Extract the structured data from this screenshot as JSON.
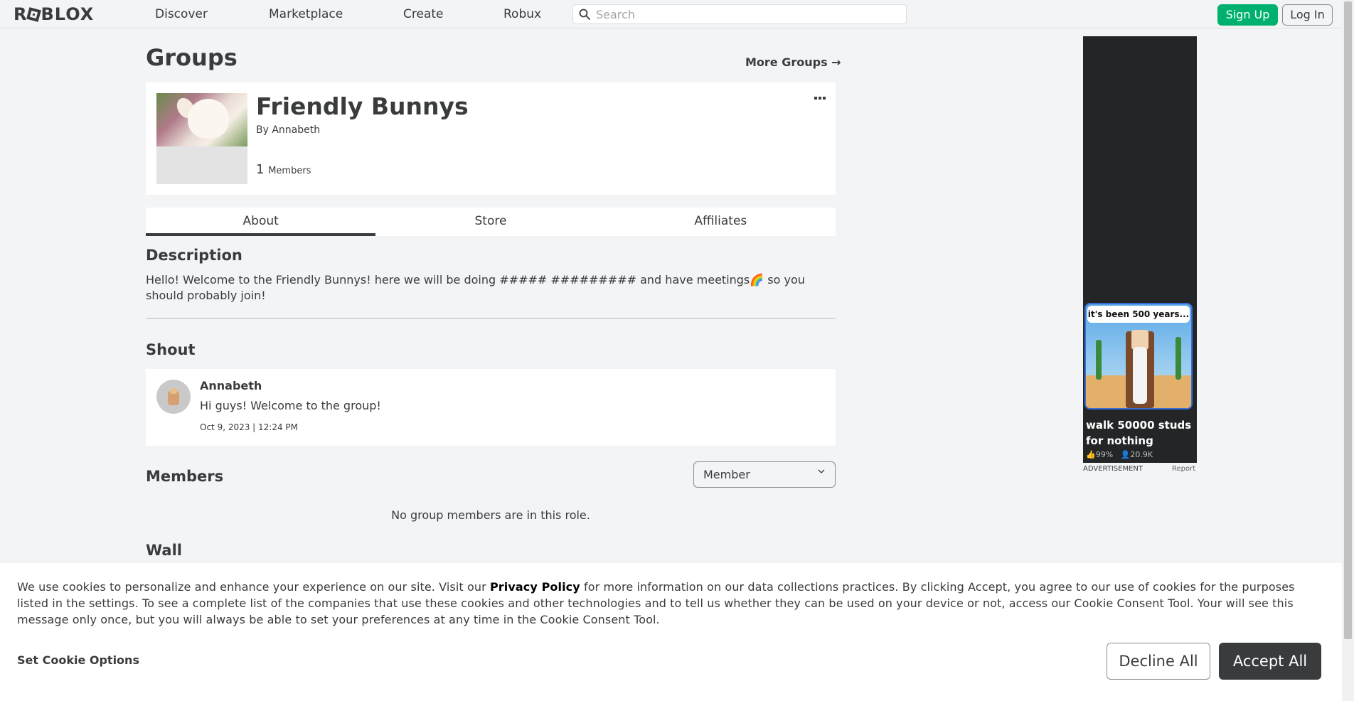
{
  "nav": {
    "logo": "ROBLOX",
    "links": [
      "Discover",
      "Marketplace",
      "Create",
      "Robux"
    ],
    "search_placeholder": "Search",
    "signup_label": "Sign Up",
    "login_label": "Log In"
  },
  "page": {
    "title": "Groups",
    "more_groups": "More Groups →"
  },
  "group": {
    "name": "Friendly Bunnys",
    "by_label": "By",
    "owner": "Annabeth",
    "member_count": "1",
    "members_label": "Members",
    "menu_icon": "ellipsis-icon"
  },
  "tabs": [
    {
      "label": "About",
      "active": true
    },
    {
      "label": "Store",
      "active": false
    },
    {
      "label": "Affiliates",
      "active": false
    }
  ],
  "description": {
    "title": "Description",
    "text": "Hello! Welcome to the Friendly Bunnys! here we will be doing ##### ######### and have meetings🌈 so you should probably join!"
  },
  "shout": {
    "title": "Shout",
    "user": "Annabeth",
    "body": "Hi guys! Welcome to the group!",
    "date": "Oct 9, 2023 | 12:24 PM"
  },
  "members": {
    "title": "Members",
    "role_selected": "Member",
    "empty_text": "No group members are in this role."
  },
  "wall": {
    "title": "Wall"
  },
  "ad": {
    "bubble": "it's been 500 years...",
    "title": "walk 50000 studs for nothing",
    "rating": "99%",
    "players": "20.9K",
    "label": "ADVERTISEMENT",
    "report": "Report"
  },
  "cookie": {
    "text_before": "We use cookies to personalize and enhance your experience on our site. Visit our ",
    "privacy_link": "Privacy Policy",
    "text_after": " for more information on our data collections practices. By clicking Accept, you agree to our use of cookies for the purposes listed in the settings. To see a complete list of the companies that use these cookies and other technologies and to tell us whether they can be used on your device or not, access our Cookie Consent Tool. Your will see this message only once, but you will always be able to set your preferences at any time in the Cookie Consent Tool.",
    "set_options": "Set Cookie Options",
    "decline": "Decline All",
    "accept": "Accept All"
  }
}
